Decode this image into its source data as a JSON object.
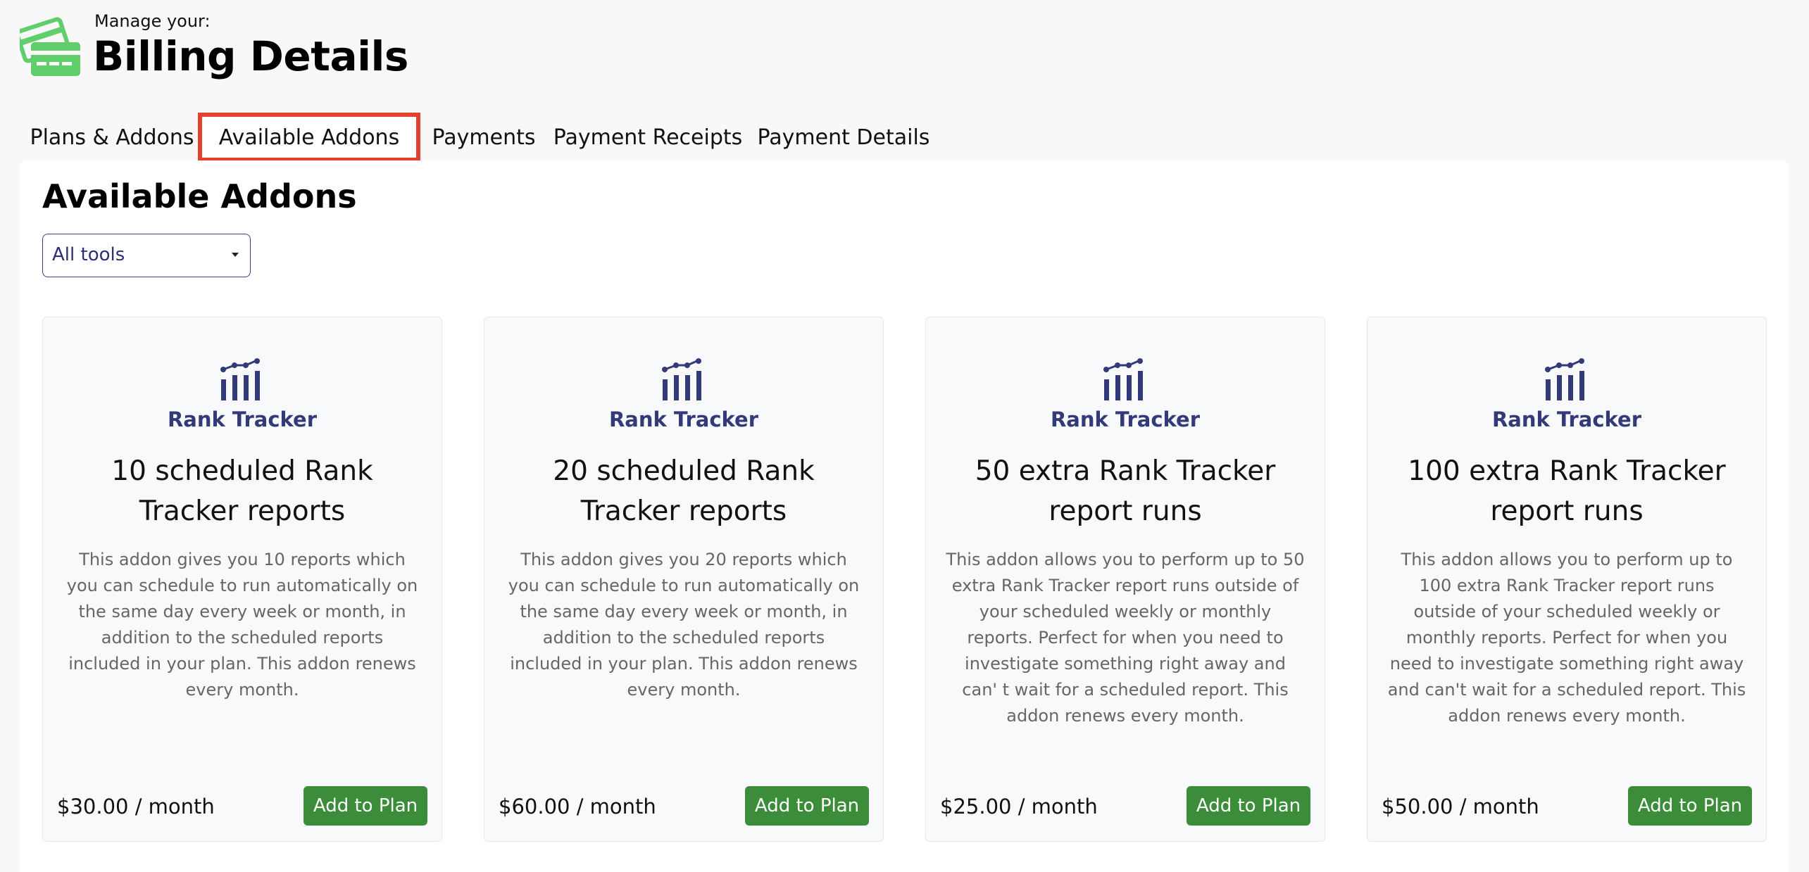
{
  "header": {
    "kicker": "Manage your:",
    "title": "Billing Details",
    "icon": "credit-card-icon",
    "icon_color": "#5fce6b"
  },
  "tabs": [
    {
      "label": "Plans & Addons",
      "active": false
    },
    {
      "label": "Available Addons",
      "active": true
    },
    {
      "label": "Payments",
      "active": false
    },
    {
      "label": "Payment Receipts",
      "active": false
    },
    {
      "label": "Payment Details",
      "active": false
    }
  ],
  "highlight_color": "#e2412d",
  "panel": {
    "title": "Available Addons",
    "filter": {
      "value": "All tools"
    }
  },
  "cards": [
    {
      "tool": "Rank Tracker",
      "icon": "rank-chart-icon",
      "title": "10 scheduled Rank Tracker reports",
      "description": "This addon gives you 10 reports which you can schedule to run automatically on the same day every week or month, in addition to the scheduled reports included in your plan. This addon renews every month.",
      "price": "$30.00 / month",
      "button": "Add to Plan"
    },
    {
      "tool": "Rank Tracker",
      "icon": "rank-chart-icon",
      "title": "20 scheduled Rank Tracker reports",
      "description": "This addon gives you 20 reports which you can schedule to run automatically on the same day every week or month, in addition to the scheduled reports included in your plan. This addon renews every month.",
      "price": "$60.00 / month",
      "button": "Add to Plan"
    },
    {
      "tool": "Rank Tracker",
      "icon": "rank-chart-icon",
      "title": "50 extra Rank Tracker report runs",
      "description": "This addon allows you to perform up to 50 extra Rank Tracker report runs outside of your scheduled weekly or monthly reports. Perfect for when you need to investigate something right away and can' t wait for a scheduled report. This addon renews every month.",
      "price": "$25.00 / month",
      "button": "Add to Plan"
    },
    {
      "tool": "Rank Tracker",
      "icon": "rank-chart-icon",
      "title": "100 extra Rank Tracker report runs",
      "description": "This addon allows you to perform up to 100 extra Rank Tracker report runs outside of your scheduled weekly or monthly reports. Perfect for when you need to investigate something right away and can't wait for a scheduled report. This addon renews every month.",
      "price": "$50.00 / month",
      "button": "Add to Plan"
    }
  ],
  "colors": {
    "accent_navy": "#333a7a",
    "button_green": "#3b8d3a"
  }
}
